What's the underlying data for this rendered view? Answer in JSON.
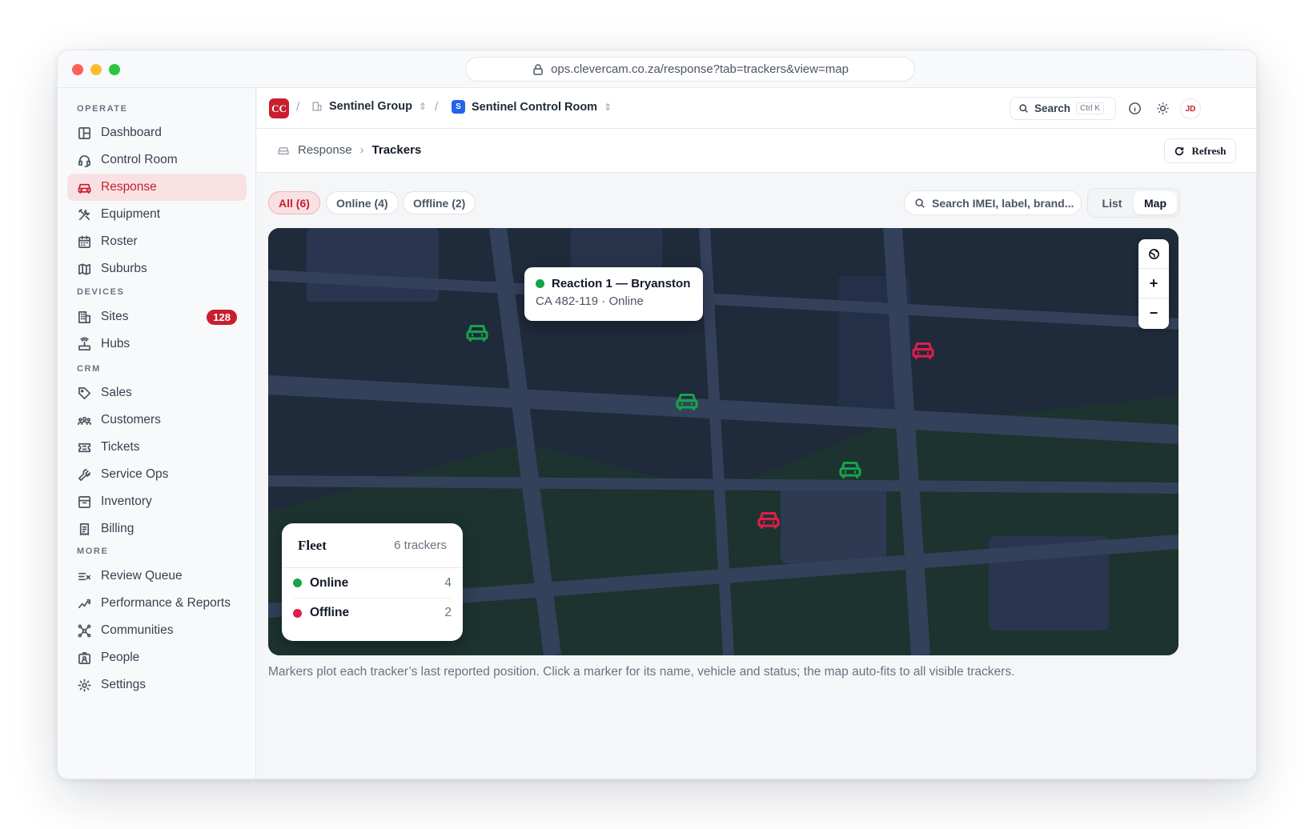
{
  "browser": {
    "url": "ops.clevercam.co.za/response?tab=trackers&view=map"
  },
  "sidebar": {
    "sections": [
      {
        "label": "OPERATE",
        "items": [
          {
            "label": "Dashboard",
            "icon": "layout-icon"
          },
          {
            "label": "Control Room",
            "icon": "headset-icon"
          },
          {
            "label": "Response",
            "icon": "car-icon",
            "active": true
          },
          {
            "label": "Equipment",
            "icon": "tools-icon"
          },
          {
            "label": "Roster",
            "icon": "calendar-icon"
          },
          {
            "label": "Suburbs",
            "icon": "map-icon"
          }
        ]
      },
      {
        "label": "DEVICES",
        "items": [
          {
            "label": "Sites",
            "icon": "building-icon",
            "badge": "128"
          },
          {
            "label": "Hubs",
            "icon": "router-icon"
          }
        ]
      },
      {
        "label": "CRM",
        "items": [
          {
            "label": "Sales",
            "icon": "tag-icon"
          },
          {
            "label": "Customers",
            "icon": "users-icon"
          },
          {
            "label": "Tickets",
            "icon": "ticket-icon"
          },
          {
            "label": "Service Ops",
            "icon": "wrench-icon"
          },
          {
            "label": "Inventory",
            "icon": "archive-icon"
          },
          {
            "label": "Billing",
            "icon": "receipt-icon"
          }
        ]
      },
      {
        "label": "MORE",
        "items": [
          {
            "label": "Review Queue",
            "icon": "list-check-icon"
          },
          {
            "label": "Performance & Reports",
            "icon": "trend-icon"
          },
          {
            "label": "Communities",
            "icon": "network-icon"
          },
          {
            "label": "People",
            "icon": "id-card-icon"
          },
          {
            "label": "Settings",
            "icon": "gear-icon"
          }
        ]
      }
    ]
  },
  "topbar": {
    "logo": "CC",
    "org": "Sentinel Group",
    "workspace_badge": "S",
    "workspace": "Sentinel Control Room",
    "search_label": "Search",
    "search_shortcut": "Ctrl K",
    "avatar": "JD"
  },
  "pagehead": {
    "crumb_parent": "Response",
    "crumb_current": "Trackers",
    "refresh_label": "Refresh"
  },
  "filters": {
    "chips": [
      {
        "label": "All (6)",
        "active": true
      },
      {
        "label": "Online (4)",
        "active": false
      },
      {
        "label": "Offline (2)",
        "active": false
      }
    ],
    "search_placeholder": "Search IMEI, label, brand...",
    "view_list": "List",
    "view_map": "Map"
  },
  "map": {
    "popup_title": "Reaction 1 — Bryanston",
    "popup_subtitle": "CA 482-119 · Online",
    "markers": [
      {
        "status": "online"
      },
      {
        "status": "online"
      },
      {
        "status": "online"
      },
      {
        "status": "offline"
      },
      {
        "status": "offline"
      }
    ],
    "controls": {
      "globe": "globe-icon",
      "zoom_in": "+",
      "zoom_out": "−"
    },
    "fleet": {
      "title": "Fleet",
      "count": "6 trackers",
      "rows": [
        {
          "label": "Online",
          "value": "4",
          "color": "#16a34a"
        },
        {
          "label": "Offline",
          "value": "2",
          "color": "#e11d48"
        }
      ]
    }
  },
  "caption": "Markers plot each tracker’s last reported position. Click a marker for its name, vehicle and status; the map auto-fits to all visible trackers.",
  "colors": {
    "accent": "#c81e2e",
    "online": "#16a34a",
    "offline": "#e11d48",
    "map_bg": "#1f2a3b"
  }
}
